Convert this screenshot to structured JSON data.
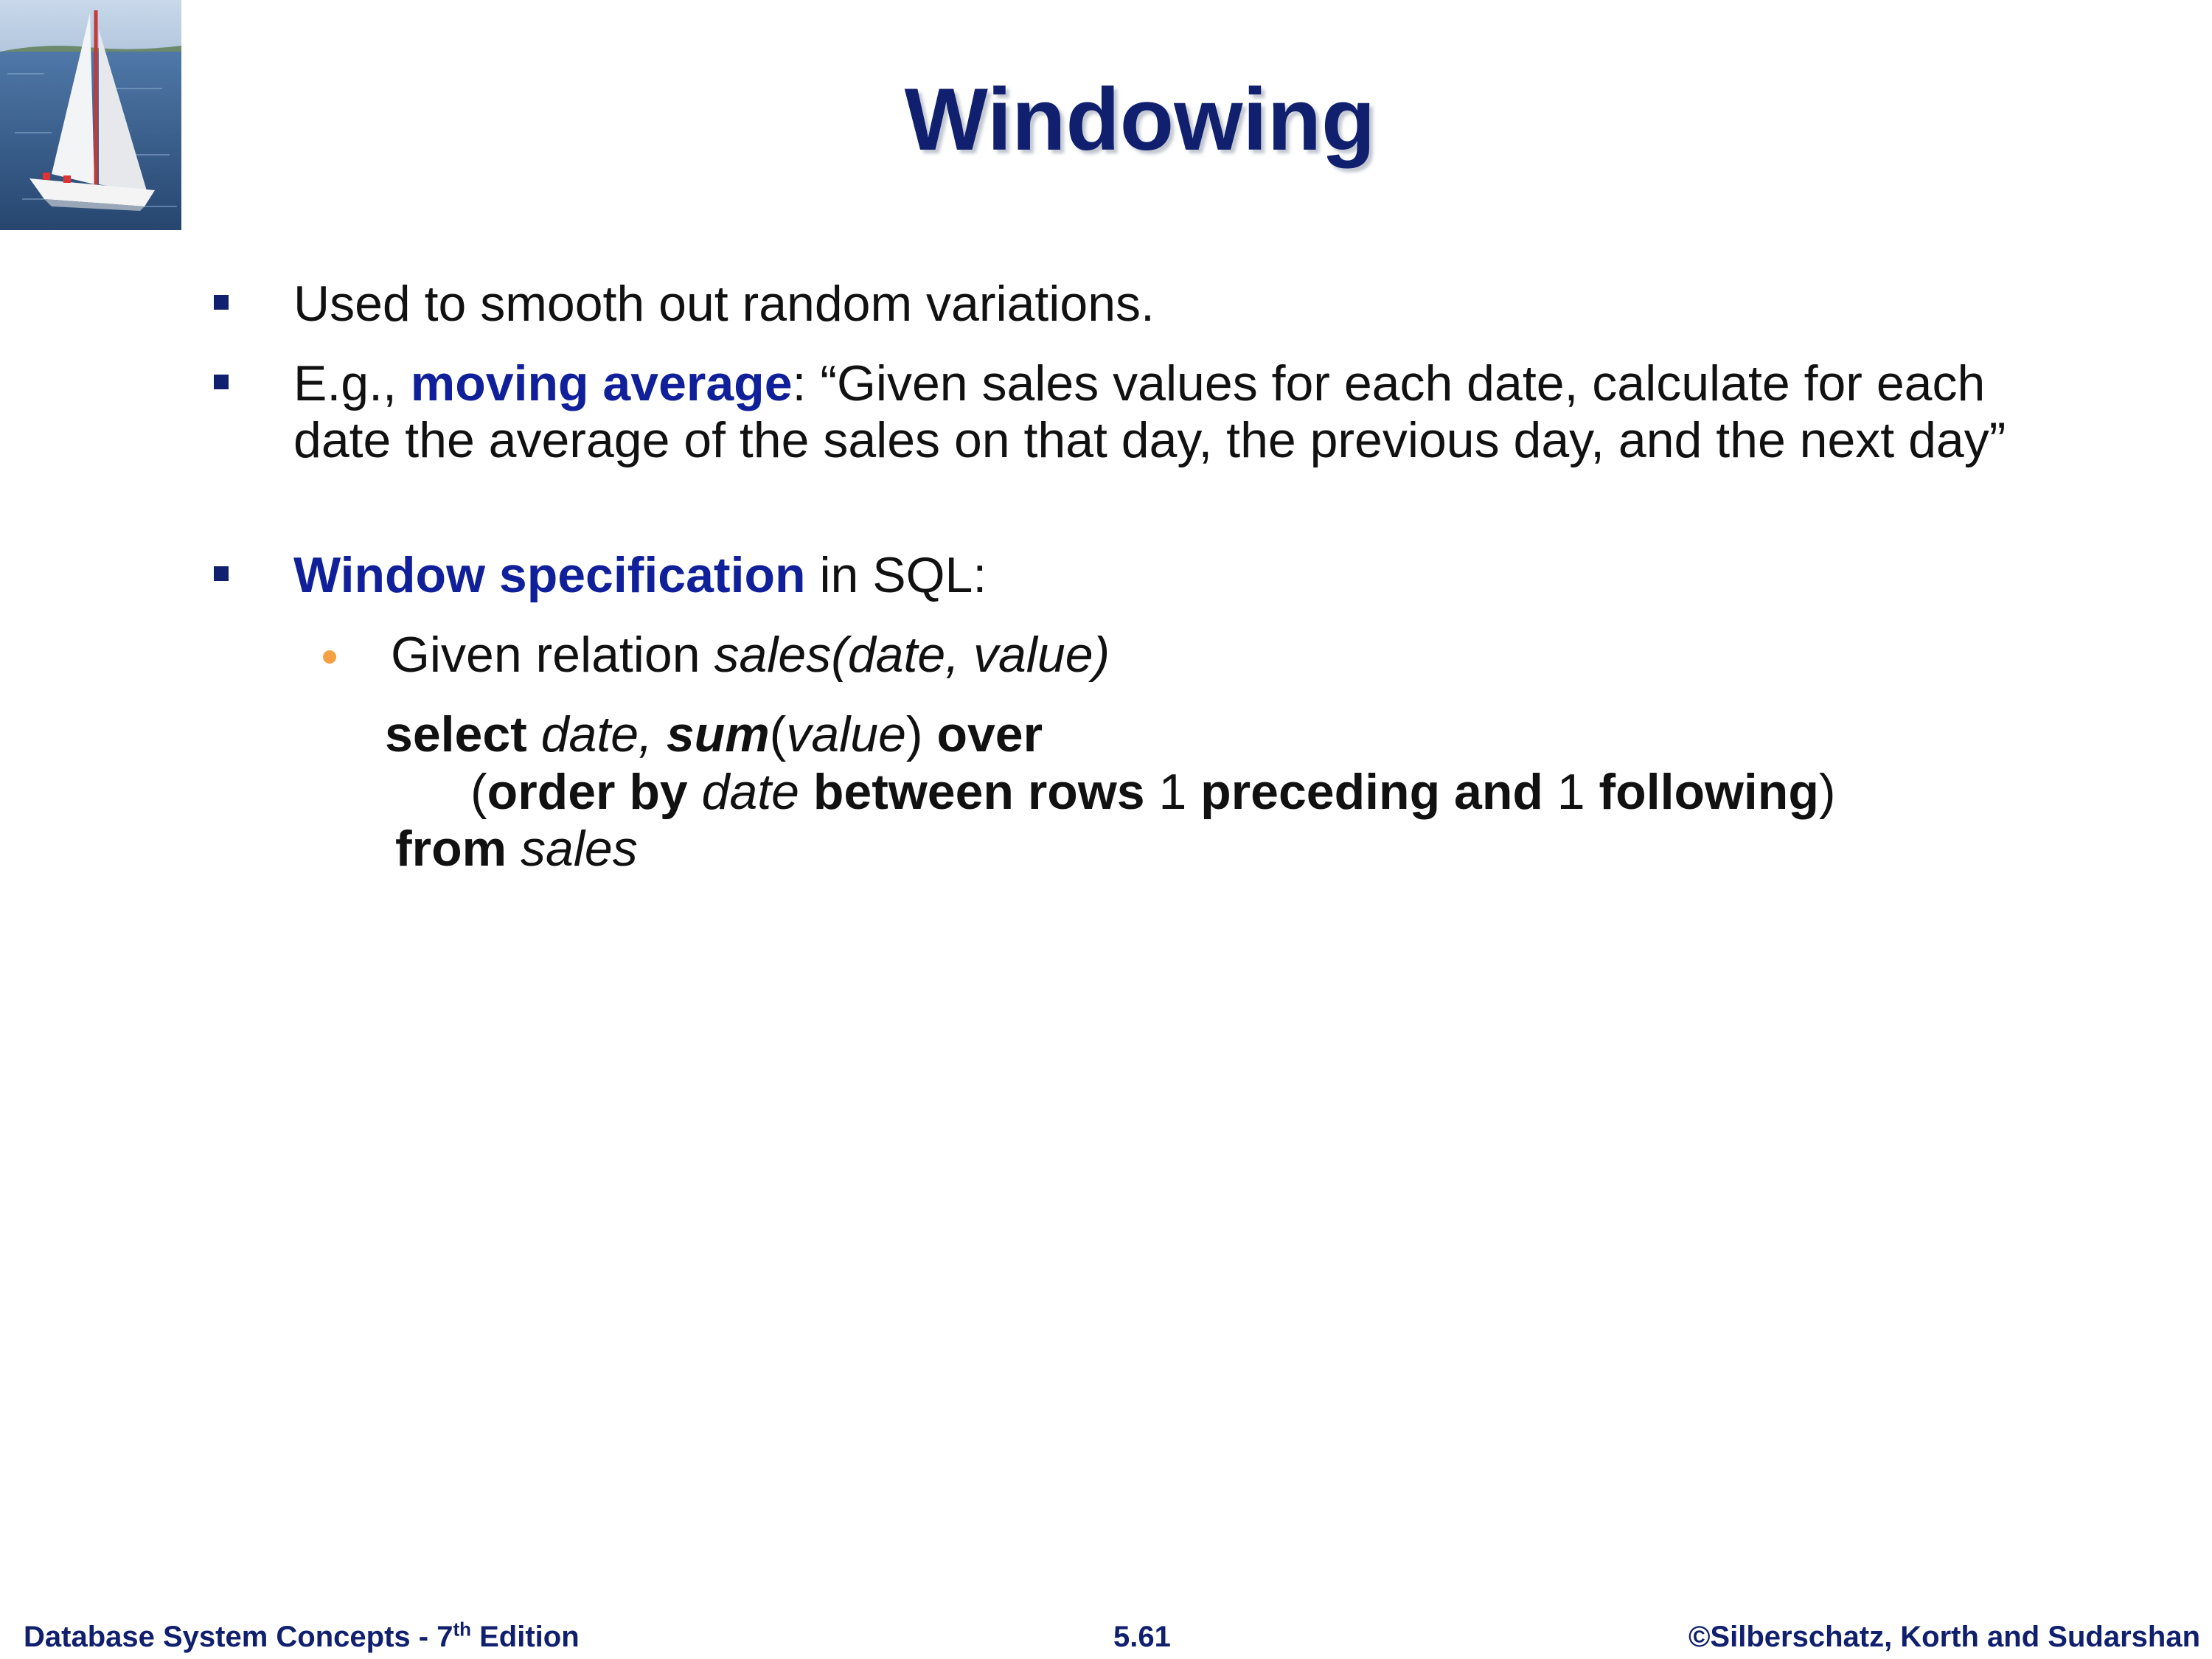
{
  "title": "Windowing",
  "logo": {
    "description_icon": "sailboat-image"
  },
  "bullets": [
    {
      "text": "Used to smooth out random variations."
    },
    {
      "prefix": "E.g., ",
      "highlight": "moving average",
      "suffix": ": “Given sales values for each date, calculate for each date the average of the sales on that day, the previous day, and the next day”"
    },
    {
      "highlight": "Window specification",
      "suffix": " in SQL:"
    }
  ],
  "sub_bullet": {
    "prefix": "Given relation ",
    "italic": "sales(date, value)"
  },
  "code": {
    "line1": {
      "kw_select": "select",
      "arg_date": " date, ",
      "fn_sum": "sum",
      "paren_open": "(",
      "arg_value": "value",
      "paren_close": ") ",
      "kw_over": "over"
    },
    "line2": {
      "paren_open": "(",
      "kw_order_by": "order by",
      "arg_date": " date ",
      "kw_between_rows": "between rows",
      "num1": " 1 ",
      "kw_preceding_and": "preceding and",
      "num2": " 1 ",
      "kw_following": "following",
      "paren_close": ")"
    },
    "line3": {
      "kw_from": "from",
      "arg_sales": " sales"
    }
  },
  "footer": {
    "left_prefix": "Database System Concepts - 7",
    "left_sup": "th",
    "left_suffix": " Edition",
    "center": "5.61",
    "right": "©Silberschatz, Korth and Sudarshan"
  },
  "colors": {
    "title": "#10206e",
    "highlight": "#10209a",
    "bullet_square": "#10206e",
    "sub_bullet_dot": "#f5a042",
    "footer": "#10206e"
  }
}
